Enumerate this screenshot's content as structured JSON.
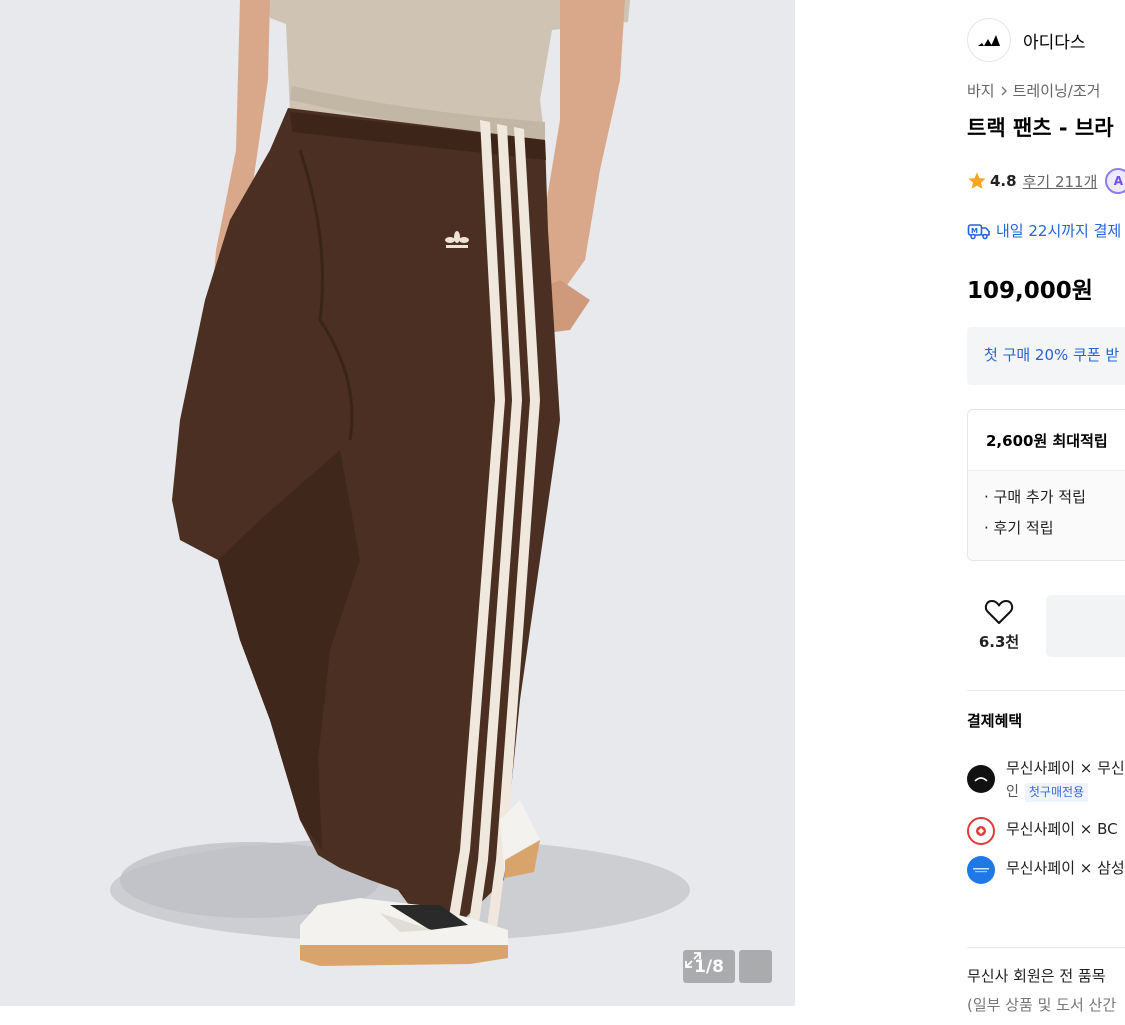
{
  "gallery": {
    "counter": "1/8",
    "expand_icon": "expand-icon"
  },
  "brand": {
    "name": "아디다스",
    "logo_icon": "adidas-logo-icon"
  },
  "breadcrumb": {
    "items": [
      "바지",
      "트레이닝/조거"
    ],
    "separator_icon": "chevron-right-icon"
  },
  "product": {
    "title": "트랙 팬츠 - 브라",
    "rating": "4.8",
    "review_text": "후기 211개",
    "badge_text": "A",
    "delivery_text": "내일 22시까지 결제",
    "price": "109,000원"
  },
  "coupon": {
    "text": "첫 구매 20% 쿠폰 받"
  },
  "points": {
    "title": "2,600원 최대적립",
    "items": [
      "· 구매 추가 적립",
      "· 후기 적립"
    ]
  },
  "like": {
    "count": "6.3천"
  },
  "payment": {
    "title": "결제혜택",
    "items": [
      {
        "text": "무신사페이 × 무신",
        "sub": "인",
        "tag": "첫구매전용",
        "logo": "musinsa-pay-logo-icon"
      },
      {
        "text": "무신사페이 × BC",
        "logo": "bc-card-logo-icon"
      },
      {
        "text": "무신사페이 × 삼성",
        "logo": "samsung-card-logo-icon"
      }
    ]
  },
  "member": {
    "text": "무신사 회원은 전 품목",
    "sub": "(일부 상품 및 도서 산간"
  },
  "colors": {
    "accent_blue": "#2563d6",
    "star": "#f5a623",
    "pants_brown": "#4a2f22",
    "gallery_bg": "#e7e9ec"
  }
}
